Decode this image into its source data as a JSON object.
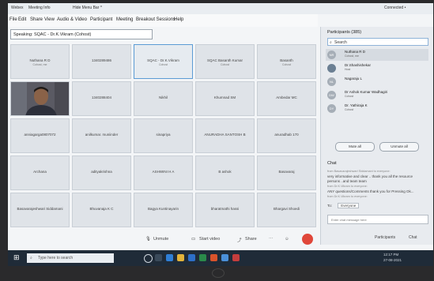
{
  "titlebar": {
    "app": "Webex",
    "meeting_info": "Meeting Info",
    "hide_menu": "Hide Menu Bar ^",
    "connected": "Connected •"
  },
  "menu": [
    "File",
    "Edit",
    "Share",
    "View",
    "Audio & Video",
    "Participant",
    "Meeting",
    "Breakout Sessions",
    "Help"
  ],
  "speaking": "Speaking: SQAC - Dr.K.Vikram (Cohost)",
  "tiles": [
    {
      "name": "Nuthana R D",
      "sub": "Cohost, me"
    },
    {
      "name": "1340289486",
      "sub": ""
    },
    {
      "name": "SQAC - Dr.K.Vikram",
      "sub": "Cohost",
      "active": true
    },
    {
      "name": "SQAC Basanth Kumar",
      "sub": "Cohost"
    },
    {
      "name": "Basanth",
      "sub": "Cohost"
    },
    {
      "name": "",
      "sub": "",
      "video": true
    },
    {
      "name": "1340288404",
      "sub": ""
    },
    {
      "name": "Nikhil",
      "sub": ""
    },
    {
      "name": "Khumnad SM",
      "sub": ""
    },
    {
      "name": "Ambedar MC",
      "sub": ""
    },
    {
      "name": "anniagarga0807072",
      "sub": ""
    },
    {
      "name": "anilkumar. muniinder",
      "sub": ""
    },
    {
      "name": "sinapriya",
      "sub": ""
    },
    {
      "name": "ANURADHA SANTOSH B",
      "sub": ""
    },
    {
      "name": "anuradhab 170",
      "sub": ""
    },
    {
      "name": "Archana",
      "sub": ""
    },
    {
      "name": "adityakrishna",
      "sub": ""
    },
    {
      "name": "ASHWINI H A",
      "sub": ""
    },
    {
      "name": "B ashok",
      "sub": ""
    },
    {
      "name": "Basavaraj",
      "sub": ""
    },
    {
      "name": "Basavarajeshwari Siddamani",
      "sub": ""
    },
    {
      "name": "Bhuvanaja K C",
      "sub": ""
    },
    {
      "name": "Bagya Kuntinayarin",
      "sub": ""
    },
    {
      "name": "bharatmathi hassi",
      "sub": ""
    },
    {
      "name": "Bhargavi Shoedi",
      "sub": ""
    }
  ],
  "controls": {
    "unmute": "Unmute",
    "start_video": "Start video",
    "share": "Share",
    "participants": "Participants",
    "chat": "Chat"
  },
  "participants_panel": {
    "title": "Participants (385)",
    "search": "Search",
    "items": [
      {
        "initials": "NR",
        "name": "Nuthana R D",
        "sub": "Cohost, me"
      },
      {
        "initials": "",
        "name": "Dr.Shashishekar",
        "sub": "Host"
      },
      {
        "initials": "NL",
        "name": "Nagaraju L",
        "sub": ""
      },
      {
        "initials": "DW",
        "name": "Dr Ashok Kumar Wadhagiri",
        "sub": "Cohost"
      },
      {
        "initials": "DY",
        "name": "Dr. Yathiraja K",
        "sub": "Cohost"
      }
    ],
    "mute_all": "Mute all",
    "unmute_all": "Unmute all"
  },
  "chat": {
    "title": "Chat",
    "lines": [
      {
        "text": "from Basavarajeshwari Siddamani to everyone:",
        "muted": true
      },
      {
        "text": "very informative and clear .. thank you all the resource"
      },
      {
        "text": "persons ..and team team"
      },
      {
        "text": "from Dr.K.Vikram to everyone:",
        "muted": true
      },
      {
        "text": "ANY questions/Comments thank you for Pressing Ok..."
      },
      {
        "text": "from Dr.K.Vikram to everyone:",
        "muted": true
      }
    ],
    "to_label": "To:",
    "to_value": "Everyone",
    "placeholder": "Enter chat message here"
  },
  "taskbar": {
    "search": "Type here to search",
    "time": "12:17 PM",
    "date": "27-08-2021"
  }
}
